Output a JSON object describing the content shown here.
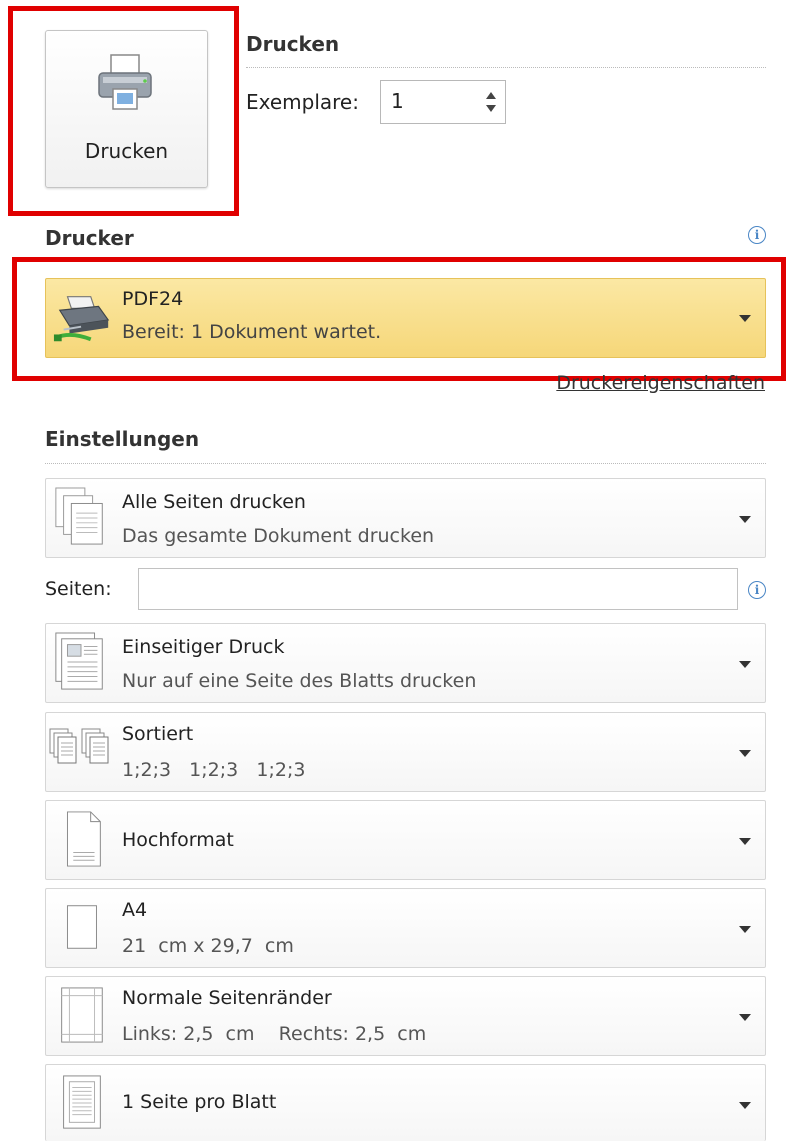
{
  "print": {
    "section_title": "Drucken",
    "button_label": "Drucken",
    "copies_label": "Exemplare:",
    "copies_value": "1"
  },
  "printer": {
    "section_title": "Drucker",
    "name": "PDF24",
    "status": "Bereit: 1 Dokument wartet.",
    "properties_link": "Druckereigenschaften"
  },
  "settings": {
    "section_title": "Einstellungen",
    "pages_label": "Seiten:",
    "pages_value": "",
    "items": [
      {
        "title": "Alle Seiten drucken",
        "subtitle": "Das gesamte Dokument drucken",
        "icon": "pages-stack-icon"
      },
      {
        "title": "Einseitiger Druck",
        "subtitle": "Nur auf eine Seite des Blatts drucken",
        "icon": "one-sided-icon"
      },
      {
        "title": "Sortiert",
        "subtitle": "1;2;3   1;2;3   1;2;3",
        "icon": "collated-icon"
      },
      {
        "title": "Hochformat",
        "subtitle": "",
        "icon": "portrait-icon"
      },
      {
        "title": "A4",
        "subtitle": "21  cm x 29,7  cm",
        "icon": "paper-size-icon"
      },
      {
        "title": "Normale Seitenränder",
        "subtitle": "Links: 2,5  cm    Rechts: 2,5  cm",
        "icon": "margins-icon"
      },
      {
        "title": "1 Seite pro Blatt",
        "subtitle": "",
        "icon": "pages-per-sheet-icon"
      }
    ]
  },
  "colors": {
    "highlight": "#e00000",
    "selected_bg": "#f6d779",
    "info_blue": "#4a86c5"
  }
}
